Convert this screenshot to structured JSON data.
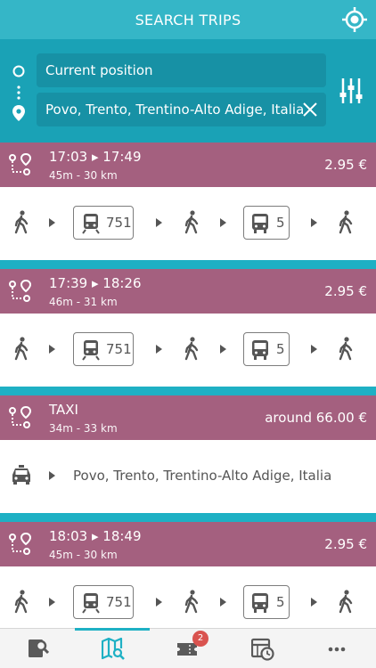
{
  "header": {
    "title": "SEARCH TRIPS",
    "gps_icon": "gps-locate-icon"
  },
  "search": {
    "from_value": "Current position",
    "to_value": "Povo, Trento, Trentino-Alto Adige, Italia"
  },
  "colors": {
    "header": "#35b6c7",
    "search": "#1aa2b6",
    "card_header": "#a4607f",
    "accent": "#1eb0c4"
  },
  "trips": [
    {
      "times": "17:03 ▸ 17:49",
      "meta": "45m - 30 km",
      "price": "2.95 €",
      "train_line": "751",
      "bus_line": "5"
    },
    {
      "times": "17:39 ▸ 18:26",
      "meta": "46m - 31 km",
      "price": "2.95 €",
      "train_line": "751",
      "bus_line": "5"
    },
    {
      "times": "TAXI",
      "meta": "34m - 33 km",
      "price": "around 66.00 €",
      "destination": "Povo, Trento, Trentino-Alto Adige, Italia"
    },
    {
      "times": "18:03 ▸ 18:49",
      "meta": "45m - 30 km",
      "price": "2.95 €",
      "train_line": "751",
      "bus_line": "5"
    }
  ],
  "tabbar": {
    "items": [
      "search-journey-icon",
      "map-search-icon",
      "tickets-icon",
      "timetable-icon",
      "more-icon"
    ],
    "active": 1,
    "badge": "2"
  }
}
